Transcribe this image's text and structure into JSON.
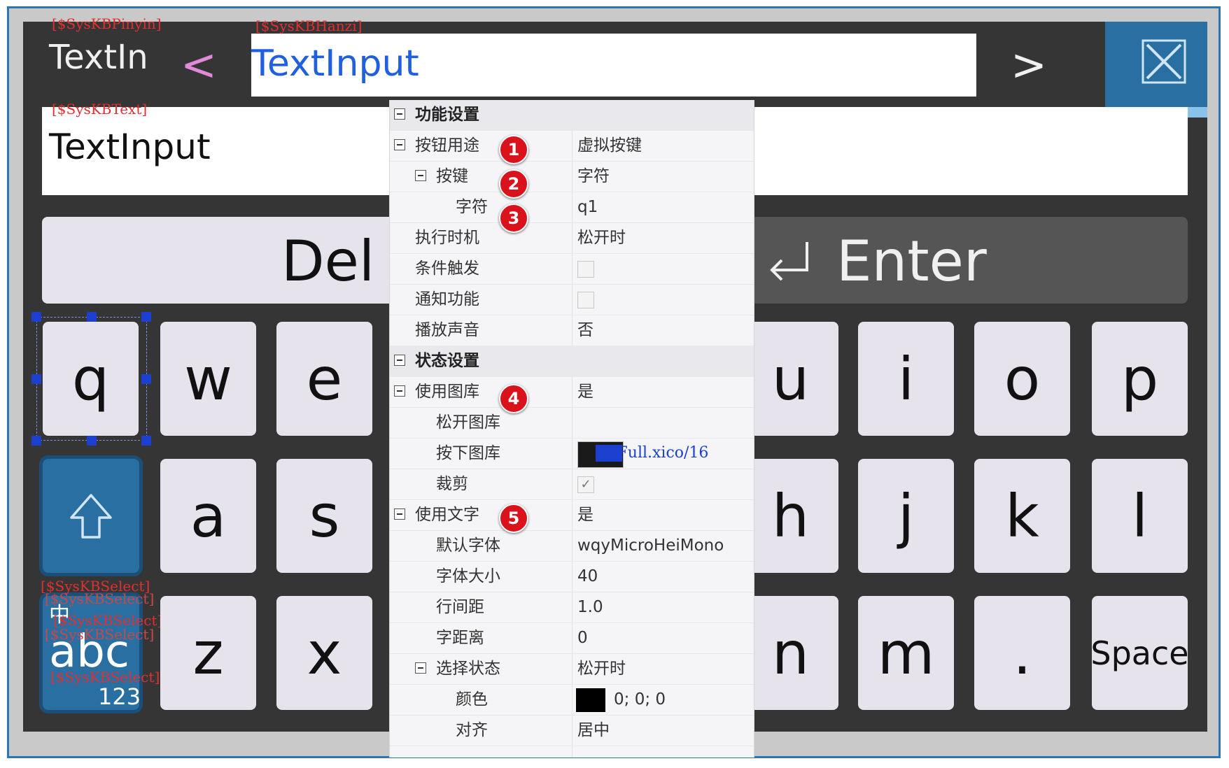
{
  "keyboard": {
    "pinyin_tag": "[$SysKBPinyin]",
    "hanzi_tag": "[$SysKBHanzi]",
    "text_tag": "[$SysKBText]",
    "select_tag": "[$SysKBSelect]",
    "pinyin_text": "TextIn",
    "prev_label": "<",
    "next_label": ">",
    "hanzi_text": "TextInput",
    "text_value": "TextInput",
    "del_label": "Del",
    "enter_label": "Enter",
    "row1": [
      "q",
      "w",
      "e",
      "u",
      "i",
      "o",
      "p"
    ],
    "row2": [
      "a",
      "s",
      "h",
      "j",
      "k",
      "l"
    ],
    "row3": [
      "z",
      "x",
      "n",
      "m",
      ".",
      "Space"
    ],
    "lang_zh": "中",
    "lang_abc": "abc",
    "lang_123": "123",
    "colors": {
      "background": "#353535",
      "key": "#e6e3ed",
      "accent": "#2a6fa1",
      "hanzi_text": "#2060e0",
      "tag": "#e03030"
    }
  },
  "properties": {
    "function_section": "功能设置",
    "button_use": {
      "label": "按钮用途",
      "value": "虚拟按键"
    },
    "key": {
      "label": "按键",
      "value": "字符"
    },
    "char": {
      "label": "字符",
      "value": "q1"
    },
    "exec_time": {
      "label": "执行时机",
      "value": "松开时"
    },
    "cond_trigger": {
      "label": "条件触发",
      "checked": false
    },
    "notify": {
      "label": "通知功能",
      "checked": false
    },
    "play_sound": {
      "label": "播放声音",
      "value": "否"
    },
    "state_section": "状态设置",
    "use_gallery": {
      "label": "使用图库",
      "value": "是"
    },
    "release_gallery": {
      "label": "松开图库",
      "value": ""
    },
    "press_gallery": {
      "label": "按下图库",
      "value": "KbFull.xico/16"
    },
    "crop": {
      "label": "裁剪",
      "checked": true
    },
    "use_text": {
      "label": "使用文字",
      "value": "是"
    },
    "default_font": {
      "label": "默认字体",
      "value": "wqyMicroHeiMono"
    },
    "font_size": {
      "label": "字体大小",
      "value": "40"
    },
    "line_spacing": {
      "label": "行间距",
      "value": "1.0"
    },
    "char_spacing": {
      "label": "字距离",
      "value": "0"
    },
    "select_state": {
      "label": "选择状态",
      "value": "松开时"
    },
    "color": {
      "label": "颜色",
      "value": "0; 0; 0",
      "swatch": "#000000"
    },
    "align": {
      "label": "对齐",
      "value": "居中"
    }
  },
  "badges": [
    "1",
    "2",
    "3",
    "4",
    "5"
  ]
}
